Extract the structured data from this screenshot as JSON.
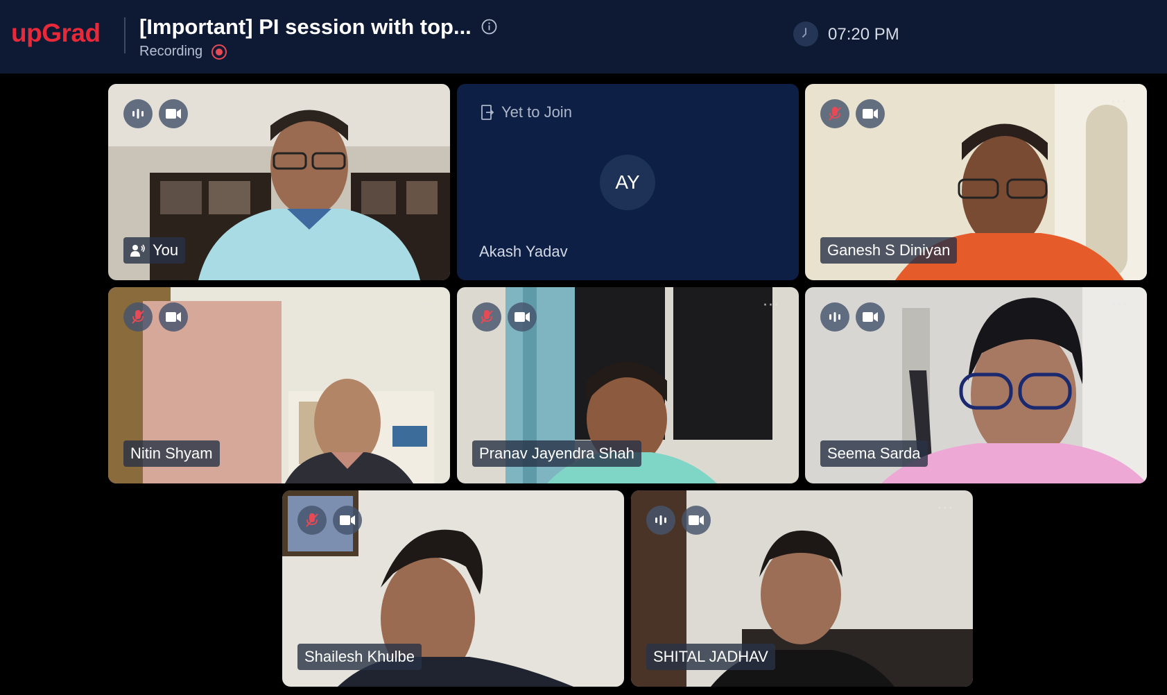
{
  "header": {
    "logo": "upGrad",
    "title": "[Important] PI session with top...",
    "recording_label": "Recording",
    "time": "07:20 PM",
    "colors": {
      "brand": "#e7293a",
      "bar_bg": "#0e1a33",
      "recording": "#e84a55"
    }
  },
  "tiles": [
    {
      "name": "You",
      "mic": "active",
      "cam": "on",
      "more": false,
      "icon": "speaker-person-icon"
    },
    {
      "name": "Akash Yadav",
      "status": "Yet to Join",
      "initials": "AY"
    },
    {
      "name": "Ganesh S Diniyan",
      "mic": "muted",
      "cam": "on",
      "more": true
    },
    {
      "name": "Nitin Shyam",
      "mic": "muted",
      "cam": "on",
      "more": true
    },
    {
      "name": "Pranav Jayendra Shah",
      "mic": "muted",
      "cam": "on",
      "more": true
    },
    {
      "name": "Seema Sarda",
      "mic": "active",
      "cam": "on",
      "more": true
    },
    {
      "name": "Shailesh Khulbe",
      "mic": "muted",
      "cam": "on",
      "more": false
    },
    {
      "name": "SHITAL JADHAV",
      "mic": "active",
      "cam": "on",
      "more": true
    }
  ]
}
